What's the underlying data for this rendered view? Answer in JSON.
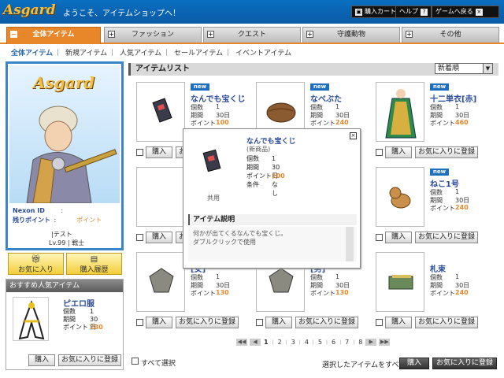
{
  "header": {
    "logo_text": "Asgard",
    "welcome": "ようこそ、アイテムショップへ！",
    "cart_label": "購入カート",
    "help_label": "ヘルプ",
    "back_label": "ゲームへ戻る"
  },
  "tabs": [
    {
      "label": "全体アイテム",
      "active": true
    },
    {
      "label": "ファッション",
      "active": false
    },
    {
      "label": "クエスト",
      "active": false
    },
    {
      "label": "守護動物",
      "active": false
    },
    {
      "label": "その他",
      "active": false
    }
  ],
  "subnav": {
    "items": [
      "全体アイテム",
      "新規アイテム",
      "人気アイテム",
      "セールアイテム",
      "イベントアイテム"
    ],
    "separator": "｜"
  },
  "profile": {
    "logo_text": "Asgard",
    "nexon_id_label": "Nexon ID",
    "colon": ":",
    "points_label": "残りポイント",
    "points_unit": "ポイント",
    "name": "|テスト",
    "level": "Lv.99 | 戦士"
  },
  "side_buttons": {
    "favorites": "お気に入り",
    "history": "購入履歴"
  },
  "recommend": {
    "title": "おすすめ人気アイテム",
    "item_name": "ピエロ服",
    "rows": [
      {
        "label": "個数",
        "value": "1"
      },
      {
        "label": "期間",
        "value": "30日"
      },
      {
        "label": "ポイント",
        "value": "230"
      }
    ],
    "buy": "購入",
    "fav": "お気に入りに登録"
  },
  "list": {
    "title": "アイテムリスト",
    "sort": "新着順"
  },
  "labels": {
    "qty": "個数",
    "period": "期間",
    "points": "ポイント",
    "new_badge": "new",
    "buy": "購入",
    "fav": "お気に入りに登録"
  },
  "items": [
    {
      "name": "なんでも宝くじ",
      "qty": "1",
      "period": "30日",
      "points": "100",
      "new": true
    },
    {
      "name": "なべぶた",
      "qty": "1",
      "period": "30日",
      "points": "240",
      "new": true
    },
    {
      "name": "十二単衣[赤]",
      "qty": "1",
      "period": "30日",
      "points": "460",
      "new": true
    },
    {
      "name": "",
      "qty": "",
      "period": "",
      "points": "",
      "new": false
    },
    {
      "name": "",
      "qty": "",
      "period": "",
      "points": "",
      "new": false
    },
    {
      "name": "ねこ1号",
      "qty": "1",
      "period": "30日",
      "points": "240",
      "new": true
    },
    {
      "name": "[女]",
      "qty": "1",
      "period": "30日",
      "points": "130",
      "new": false
    },
    {
      "name": "[男]",
      "qty": "1",
      "period": "30日",
      "points": "130",
      "new": false
    },
    {
      "name": "札束",
      "qty": "1",
      "period": "30日",
      "points": "240",
      "new": false
    }
  ],
  "popup": {
    "name": "なんでも宝くじ",
    "sub": "(新商品)",
    "rows": [
      {
        "label": "個数",
        "value": "1"
      },
      {
        "label": "期間",
        "value": "30日"
      },
      {
        "label": "ポイント",
        "value": "100"
      },
      {
        "label": "条件",
        "value": "なし"
      }
    ],
    "common": "共用",
    "desc_title": "アイテム説明",
    "desc_lines": [
      "何かが出てくるなんでも宝くじ。",
      "ダブルクリックで使用"
    ]
  },
  "pager": {
    "pages": [
      "1",
      "2",
      "3",
      "4",
      "5",
      "6",
      "7",
      "8"
    ],
    "current": "1"
  },
  "footer": {
    "select_all": "すべて選択",
    "selected_all": "選択したアイテムをすべて",
    "buy": "購入",
    "fav": "お気に入りに登録"
  }
}
